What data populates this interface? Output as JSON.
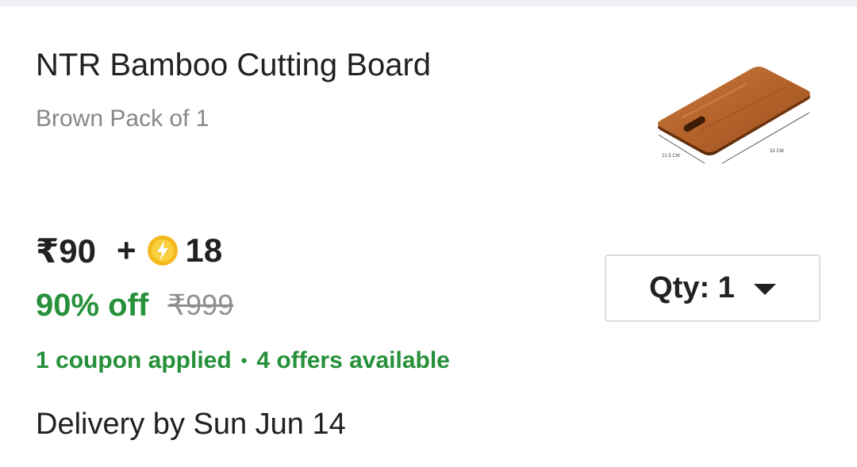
{
  "product": {
    "title": "NTR Bamboo Cutting Board",
    "variant": "Brown Pack of 1",
    "image_icon": "cutting-board-image",
    "image_dimension_labels": [
      "21.5 CM",
      "33 CM"
    ]
  },
  "pricing": {
    "price": "₹90",
    "plus": "+",
    "coin_icon": "supercoin-icon",
    "coins": "18",
    "discount": "90% off",
    "mrp": "₹999"
  },
  "offers": {
    "coupon_text": "1 coupon applied",
    "separator": "•",
    "offers_text": "4 offers available"
  },
  "delivery": {
    "text": "Delivery by Sun Jun 14"
  },
  "quantity": {
    "label": "Qty: 1",
    "icon": "chevron-down-icon"
  },
  "colors": {
    "green": "#26903a",
    "text": "#212121",
    "muted": "#878787",
    "coin": "#f7c21a"
  }
}
